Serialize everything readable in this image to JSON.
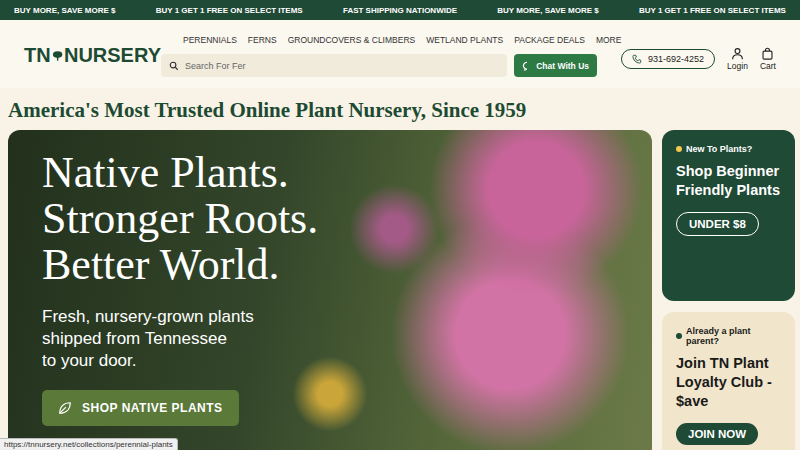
{
  "announcements": [
    "BUY MORE, SAVE MORE $",
    "BUY 1 GET 1 FREE ON SELECT ITEMS",
    "FAST SHIPPING NATIONWIDE",
    "BUY MORE, SAVE MORE $",
    "BUY 1 GET 1 FREE ON SELECT ITEMS"
  ],
  "logo": {
    "left": "TN",
    "right": "NURSERY"
  },
  "nav": [
    "PERENNIALS",
    "FERNS",
    "GROUNDCOVERS & CLIMBERS",
    "WETLAND PLANTS",
    "PACKAGE DEALS",
    "MORE"
  ],
  "search": {
    "placeholder": "Search For Fer"
  },
  "chat_button": "Chat With Us",
  "phone": "931-692-4252",
  "account": {
    "login": "Login",
    "cart": "Cart"
  },
  "headline": "America's Most Trusted Online Plant Nursery, Since 1959",
  "hero": {
    "title_lines": [
      "Native Plants.",
      "Stronger Roots.",
      "Better World."
    ],
    "subtitle_lines": [
      "Fresh, nursery-grown plants",
      "shipped from Tennessee",
      "to your door."
    ],
    "button": "SHOP NATIVE PLANTS"
  },
  "promo_cards": [
    {
      "kind": "dark",
      "eyebrow": "New To Plants?",
      "title": "Shop Beginner Friendly Plants",
      "button": "UNDER $8"
    },
    {
      "kind": "light",
      "eyebrow": "Already a plant parent?",
      "title": "Join TN Plant Loyalty Club - $ave",
      "button": "JOIN NOW"
    }
  ],
  "status_url": "https://tnnursery.net/collections/perennial-plants"
}
